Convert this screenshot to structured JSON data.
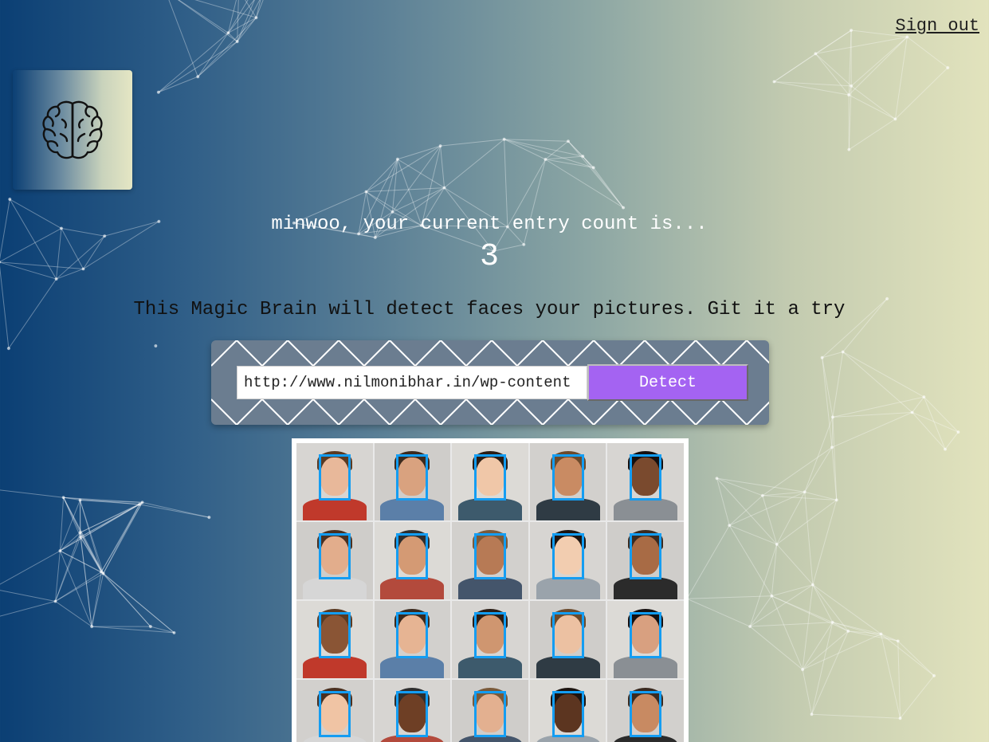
{
  "header": {
    "sign_out_label": "Sign out"
  },
  "logo": {
    "icon": "brain-icon"
  },
  "rank": {
    "message": "minwoo, your current entry count is...",
    "count": "3"
  },
  "intro": {
    "tagline": "This Magic Brain will detect faces your pictures. Git it a try"
  },
  "form": {
    "image_url": "http://www.nilmonibhar.in/wp-content",
    "detect_label": "Detect"
  },
  "image": {
    "description_icon": "faces-photo",
    "detected_face_count": 20
  },
  "colors": {
    "accent_button": "#a463f2",
    "bounding_box": "#149df2",
    "panel": "#6b7d90"
  }
}
